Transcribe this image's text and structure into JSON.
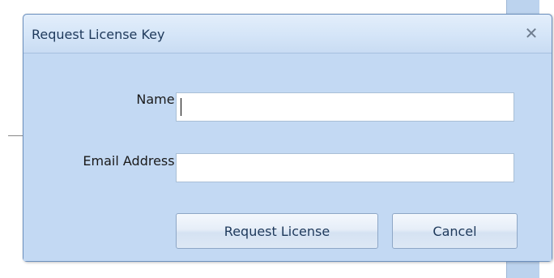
{
  "dialog": {
    "title": "Request License Key",
    "close_glyph": "✕",
    "name_label": "Name:",
    "name_value": "",
    "email_label": "Email Address:",
    "email_value": "",
    "request_button_label": "Request License",
    "cancel_button_label": "Cancel"
  },
  "icons": {
    "close": "close-icon"
  },
  "colors": {
    "dialog_background": "#c3d9f3",
    "title_text": "#1e395b",
    "field_border": "#a9bfd6"
  }
}
